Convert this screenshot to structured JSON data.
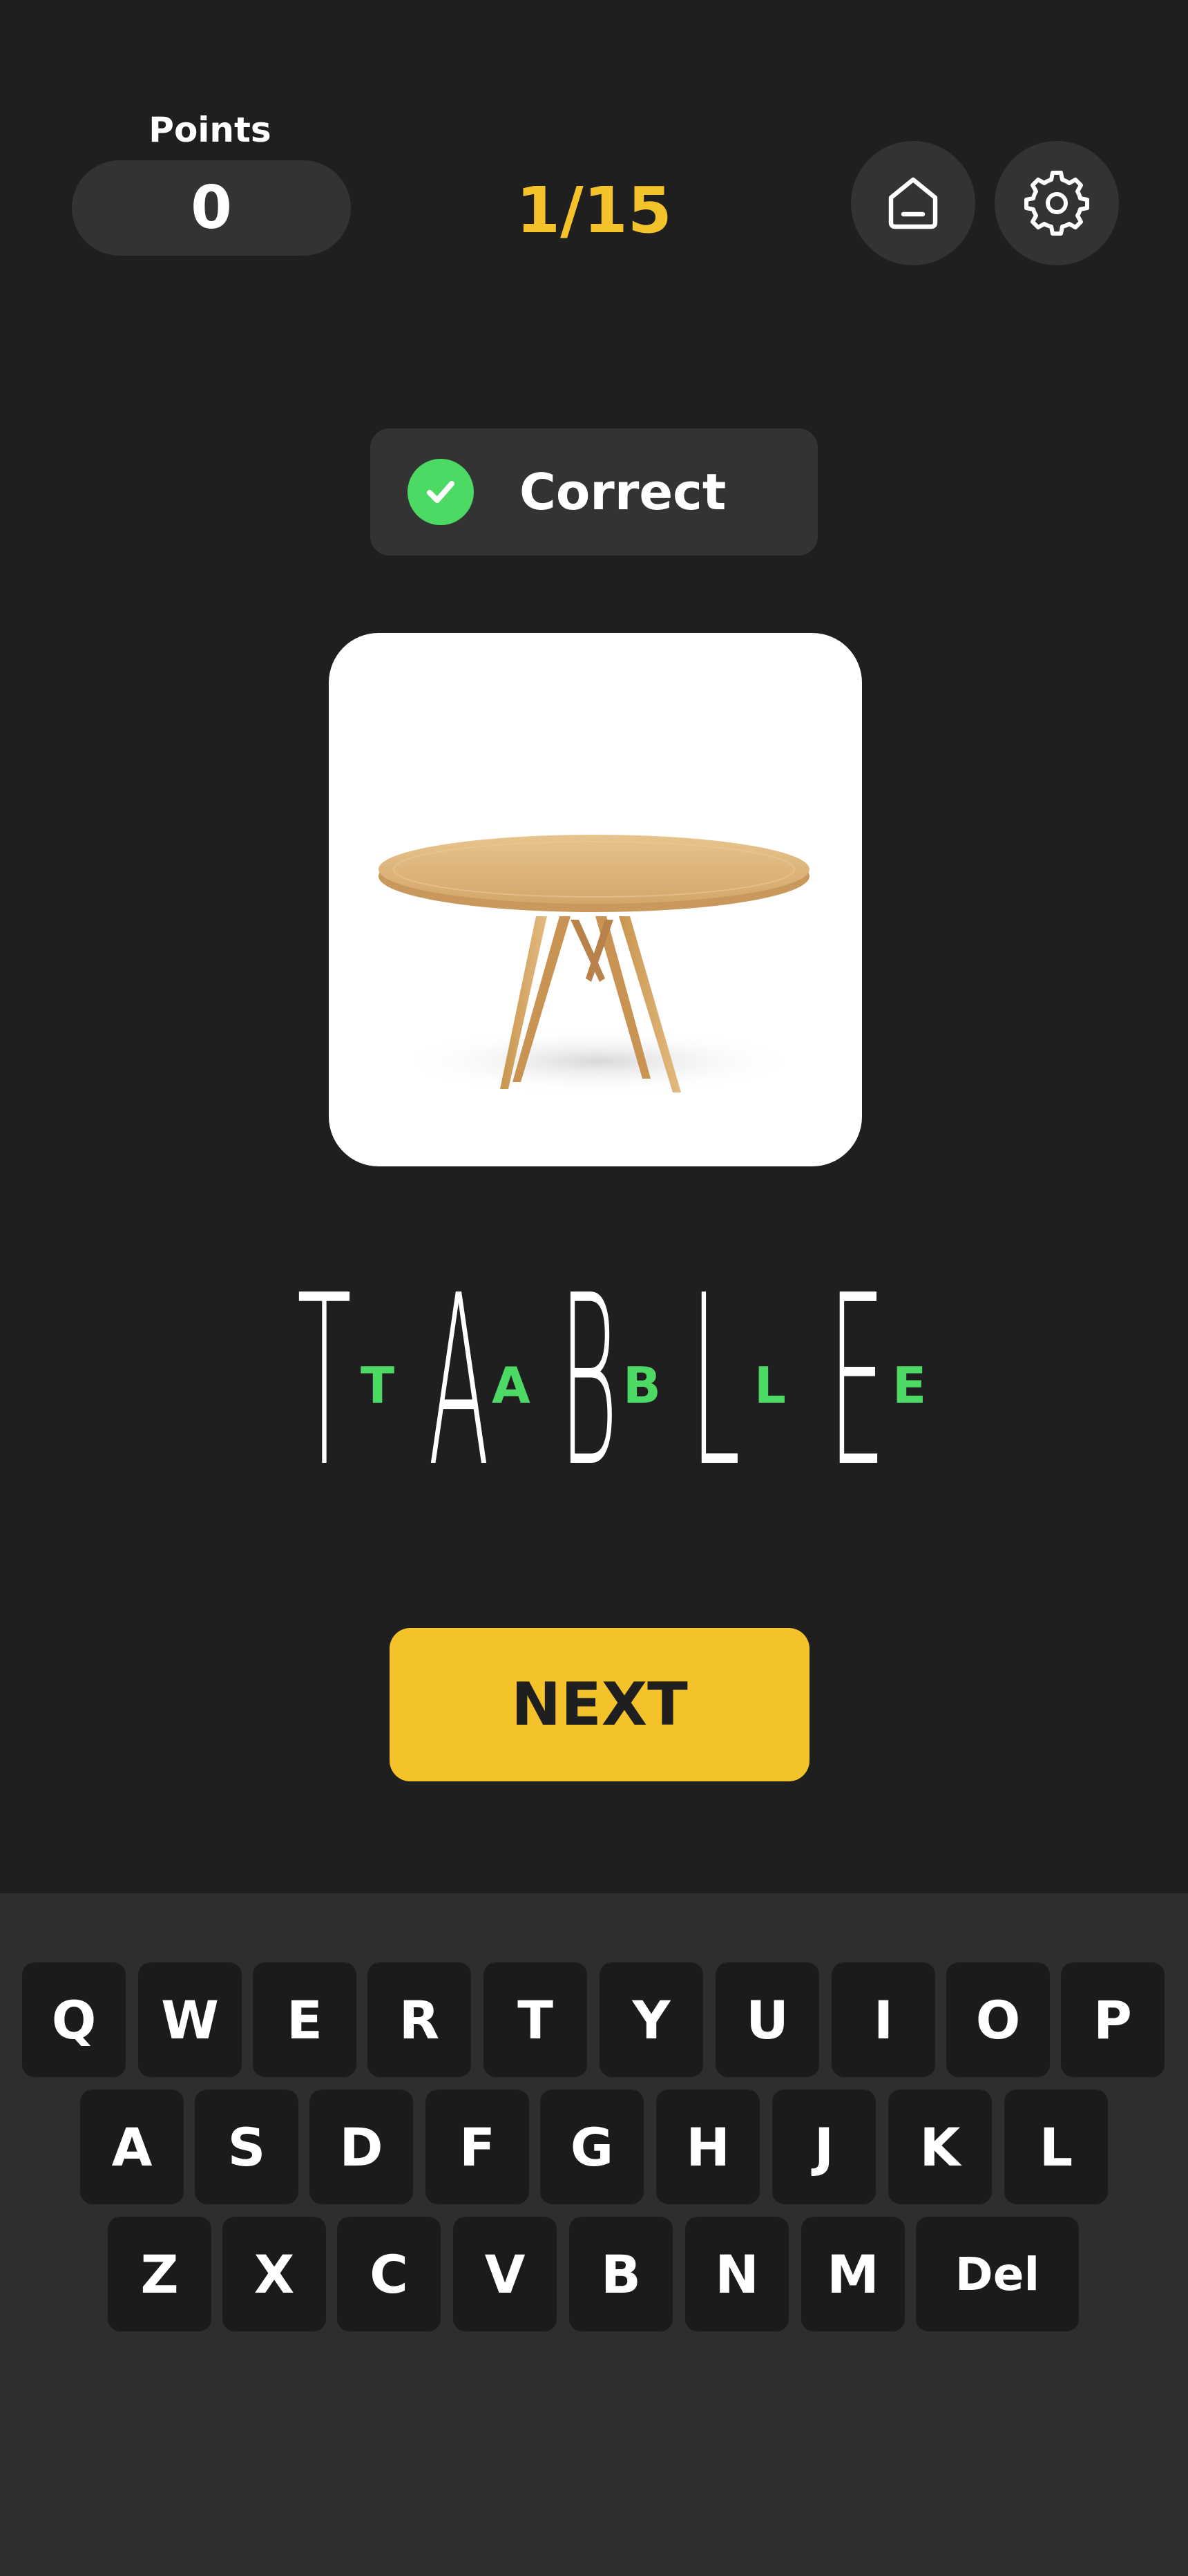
{
  "header": {
    "points_label": "Points",
    "points_value": "0",
    "progress": "1/15",
    "home_icon": "home-icon",
    "settings_icon": "gear-icon"
  },
  "status": {
    "label": "Correct",
    "icon": "check-circle-icon",
    "color": "#4cd964"
  },
  "image": {
    "subject": "round wooden table"
  },
  "answer": {
    "letters": [
      {
        "big": "T",
        "small": "T"
      },
      {
        "big": "A",
        "small": "A"
      },
      {
        "big": "B",
        "small": "B"
      },
      {
        "big": "L",
        "small": "L"
      },
      {
        "big": "E",
        "small": "E"
      }
    ]
  },
  "next_button": {
    "label": "NEXT",
    "color": "#f4c22b"
  },
  "keyboard": {
    "row1": [
      "Q",
      "W",
      "E",
      "R",
      "T",
      "Y",
      "U",
      "I",
      "O",
      "P"
    ],
    "row2": [
      "A",
      "S",
      "D",
      "F",
      "G",
      "H",
      "J",
      "K",
      "L"
    ],
    "row3": [
      "Z",
      "X",
      "C",
      "V",
      "B",
      "N",
      "M"
    ],
    "delete_label": "Del"
  },
  "colors": {
    "background": "#1f1f1f",
    "surface": "#333333",
    "accent_yellow": "#f4c22b",
    "success_green": "#4cd964"
  }
}
